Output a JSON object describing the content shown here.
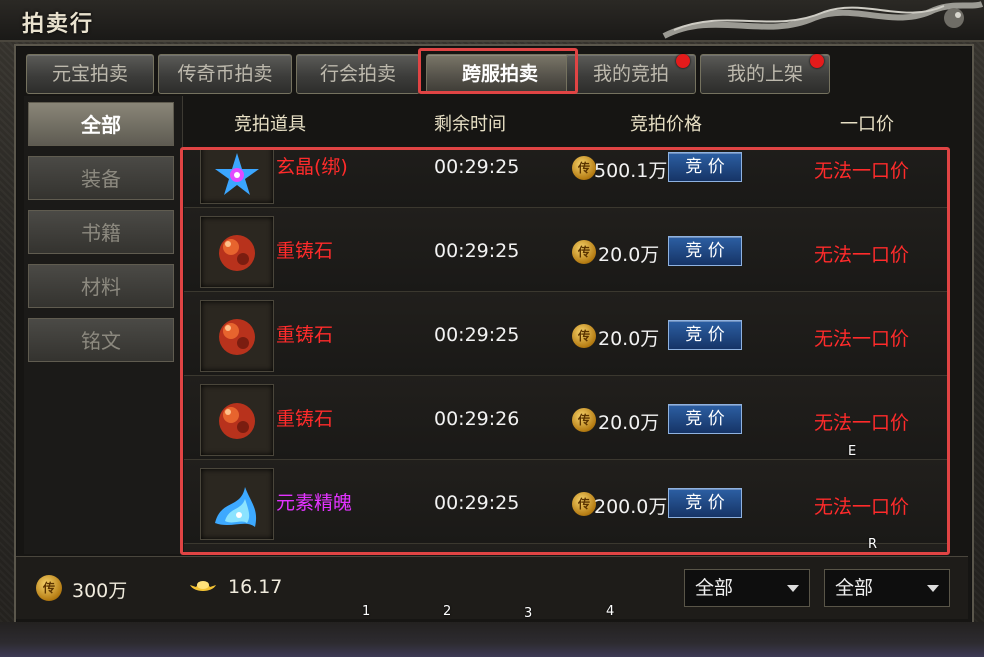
{
  "window": {
    "title": "拍卖行"
  },
  "tabs": [
    {
      "label": "元宝拍卖"
    },
    {
      "label": "传奇币拍卖"
    },
    {
      "label": "行会拍卖"
    },
    {
      "label": "跨服拍卖",
      "active": true
    },
    {
      "label": "我的竞拍",
      "badge": true
    },
    {
      "label": "我的上架",
      "badge": true
    }
  ],
  "categories": [
    {
      "label": "全部",
      "active": true
    },
    {
      "label": "装备"
    },
    {
      "label": "书籍"
    },
    {
      "label": "材料"
    },
    {
      "label": "铭文"
    }
  ],
  "columns": {
    "item": "竞拍道具",
    "time": "剩余时间",
    "price": "竞拍价格",
    "buyout": "一口价"
  },
  "rows": [
    {
      "name": "玄晶(绑)",
      "name_color": "#ff2b2b",
      "icon": "blue-crystal-icon",
      "time": "00:29:25",
      "price": "500.1万",
      "bid": "竞 价",
      "buyout": "无法一口价"
    },
    {
      "name": "重铸石",
      "name_color": "#ff2b2b",
      "icon": "red-ore-icon",
      "time": "00:29:25",
      "price": "20.0万",
      "bid": "竞 价",
      "buyout": "无法一口价"
    },
    {
      "name": "重铸石",
      "name_color": "#ff2b2b",
      "icon": "red-ore-icon",
      "time": "00:29:25",
      "price": "20.0万",
      "bid": "竞 价",
      "buyout": "无法一口价"
    },
    {
      "name": "重铸石",
      "name_color": "#ff2b2b",
      "icon": "red-ore-icon",
      "time": "00:29:26",
      "price": "20.0万",
      "bid": "竞 价",
      "buyout": "无法一口价"
    },
    {
      "name": "元素精魄",
      "name_color": "#e233ff",
      "icon": "blue-spirit-icon",
      "time": "00:29:25",
      "price": "200.0万",
      "bid": "竞 价",
      "buyout": "无法一口价"
    }
  ],
  "coin_glyph": "传",
  "footer": {
    "gold": "300万",
    "ingot": "16.17",
    "filter1": "全部",
    "filter2": "全部"
  },
  "markers": [
    "E",
    "R",
    "1",
    "2",
    "3",
    "4"
  ],
  "colors": {
    "highlight": "#e04444",
    "buyout": "#ff2b2b",
    "bid_button": "#1f4a8a"
  }
}
